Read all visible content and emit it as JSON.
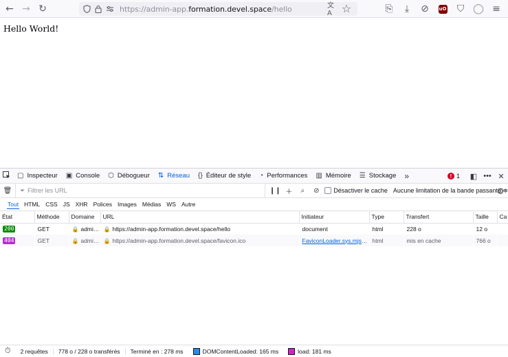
{
  "browser": {
    "url_prefix": "https://admin-app.",
    "url_host": "formation.devel.space",
    "url_path": "/hello"
  },
  "page": {
    "content_text": "Hello World!"
  },
  "devtools": {
    "tabs": [
      {
        "label": "Inspecteur"
      },
      {
        "label": "Console"
      },
      {
        "label": "Débogueur"
      },
      {
        "label": "Réseau"
      },
      {
        "label": "Éditeur de style"
      },
      {
        "label": "Performances"
      },
      {
        "label": "Mémoire"
      },
      {
        "label": "Stockage"
      }
    ],
    "error_count": "1",
    "filter_placeholder": "Filtrer les URL",
    "disable_cache_label": "Désactiver le cache",
    "throttle_label": "Aucune limitation de la bande passante ≑",
    "type_filters": [
      "Tout",
      "HTML",
      "CSS",
      "JS",
      "XHR",
      "Polices",
      "Images",
      "Médias",
      "WS",
      "Autre"
    ],
    "columns": [
      "État",
      "Méthode",
      "Domaine",
      "URL",
      "Initiateur",
      "Type",
      "Transfert",
      "Taille",
      "Cache"
    ],
    "columns_short": {
      "cache": "Ca"
    },
    "requests": [
      {
        "status": "200",
        "status_color": "#058b00",
        "method": "GET",
        "domain": "admi…",
        "url": "https://admin-app.formation.devel.space/hello",
        "initiator": "document",
        "type": "html",
        "transfer": "228 o",
        "size": "12 o"
      },
      {
        "status": "404",
        "status_color": "#b72cd2",
        "method": "GET",
        "domain": "admi…",
        "url": "https://admin-app.formation.devel.space/favicon.ico",
        "initiator": "FaviconLoader.sys.mjs:1…",
        "type": "html",
        "transfer": "mis en cache",
        "size": "766 o"
      }
    ],
    "statusbar": {
      "requests": "2 requêtes",
      "transferred": "778 o / 228 o transférés",
      "finished": "Terminé en : 278 ms",
      "dom_loaded": "DOMContentLoaded: 165 ms",
      "dom_color": "#2e8ae6",
      "load": "load: 181 ms",
      "load_color": "#c62bbd"
    }
  }
}
